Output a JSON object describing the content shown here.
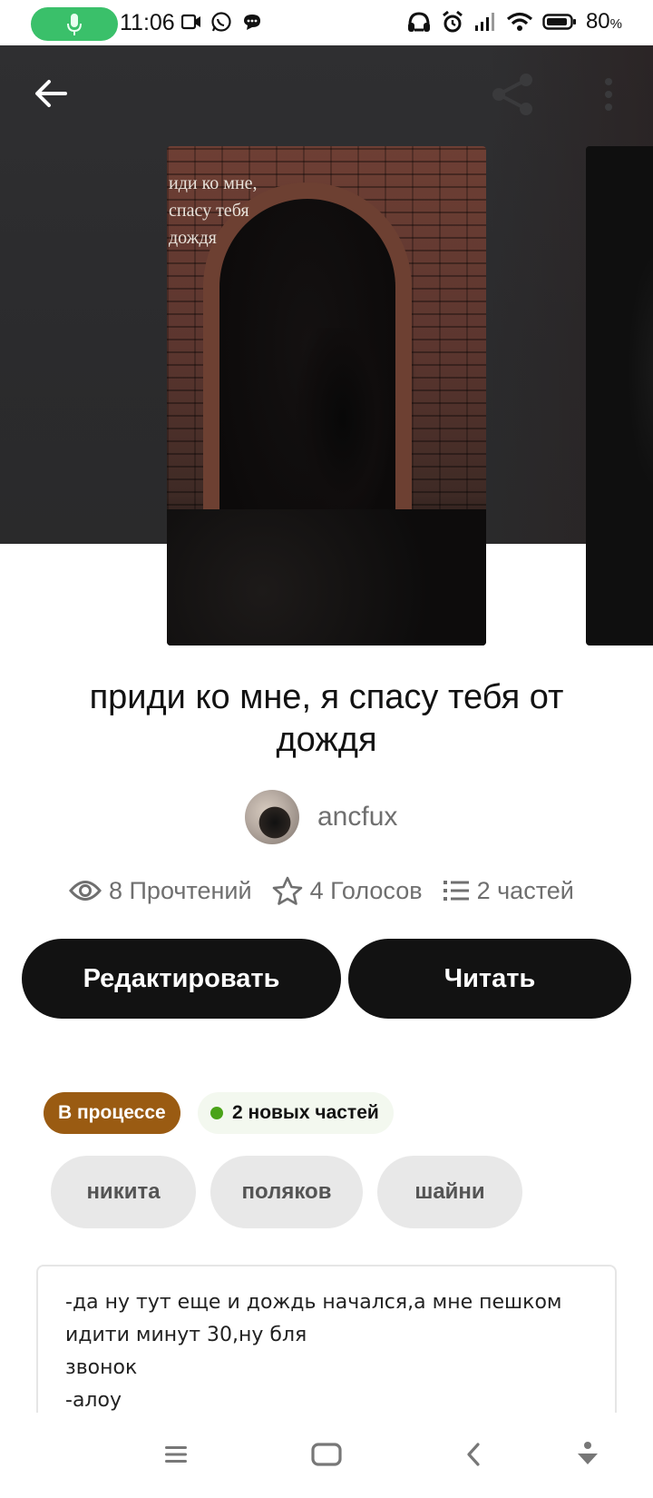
{
  "status_bar": {
    "time": "11:06",
    "battery": "80",
    "battery_unit": "%",
    "mic_color": "#3ac06a"
  },
  "header": {
    "back_icon": "arrow-left-icon",
    "share_icon": "share-icon",
    "more_icon": "more-vertical-icon"
  },
  "cover": {
    "text_lines": [
      "иди ко мне,",
      "спасу тебя",
      "дождя"
    ]
  },
  "story": {
    "title": "приди ко мне, я спасу тебя от дождя"
  },
  "author": {
    "name": "ancfux"
  },
  "stats": {
    "reads": "8 Прочтений",
    "votes": "4 Голосов",
    "parts": "2 частей"
  },
  "buttons": {
    "edit": "Редактировать",
    "read": "Читать"
  },
  "badges": {
    "status": "В процессе",
    "status_color": "#9a5b12",
    "new_parts": "2 новых частей",
    "new_dot_color": "#4aa318"
  },
  "tags": [
    "никита",
    "поляков",
    "шайни"
  ],
  "excerpt": {
    "line1": "-да ну тут еще и дождь начался,а мне пешком",
    "line2": "идити минут 30,ну бля",
    "line3": "звонок",
    "line4": "-алоу"
  }
}
